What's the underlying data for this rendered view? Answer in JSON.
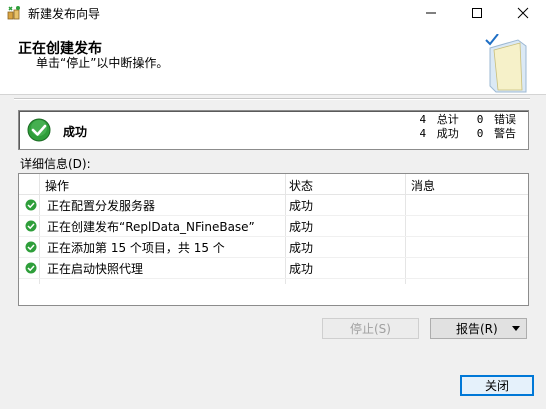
{
  "window": {
    "title": "新建发布向导"
  },
  "header": {
    "title": "正在创建发布",
    "subtitle": "单击“停止”以中断操作。"
  },
  "summary": {
    "status": "成功",
    "stats": [
      {
        "count": "4",
        "label": "总计",
        "count2": "0",
        "label2": "错误"
      },
      {
        "count": "4",
        "label": "成功",
        "count2": "0",
        "label2": "警告"
      }
    ]
  },
  "details": {
    "label": "详细信息(D):",
    "columns": [
      "操作",
      "状态",
      "消息"
    ],
    "rows": [
      {
        "action": "正在配置分发服务器",
        "status": "成功",
        "message": ""
      },
      {
        "action": "正在创建发布“ReplData_NFineBase”",
        "status": "成功",
        "message": ""
      },
      {
        "action": "正在添加第 15 个项目，共 15 个",
        "status": "成功",
        "message": ""
      },
      {
        "action": "正在启动快照代理",
        "status": "成功",
        "message": ""
      }
    ]
  },
  "buttons": {
    "stop": "停止(S)",
    "report": "报告(R)",
    "close": "关闭"
  },
  "colors": {
    "success": "#2e9e3a",
    "accent": "#0078d7"
  }
}
